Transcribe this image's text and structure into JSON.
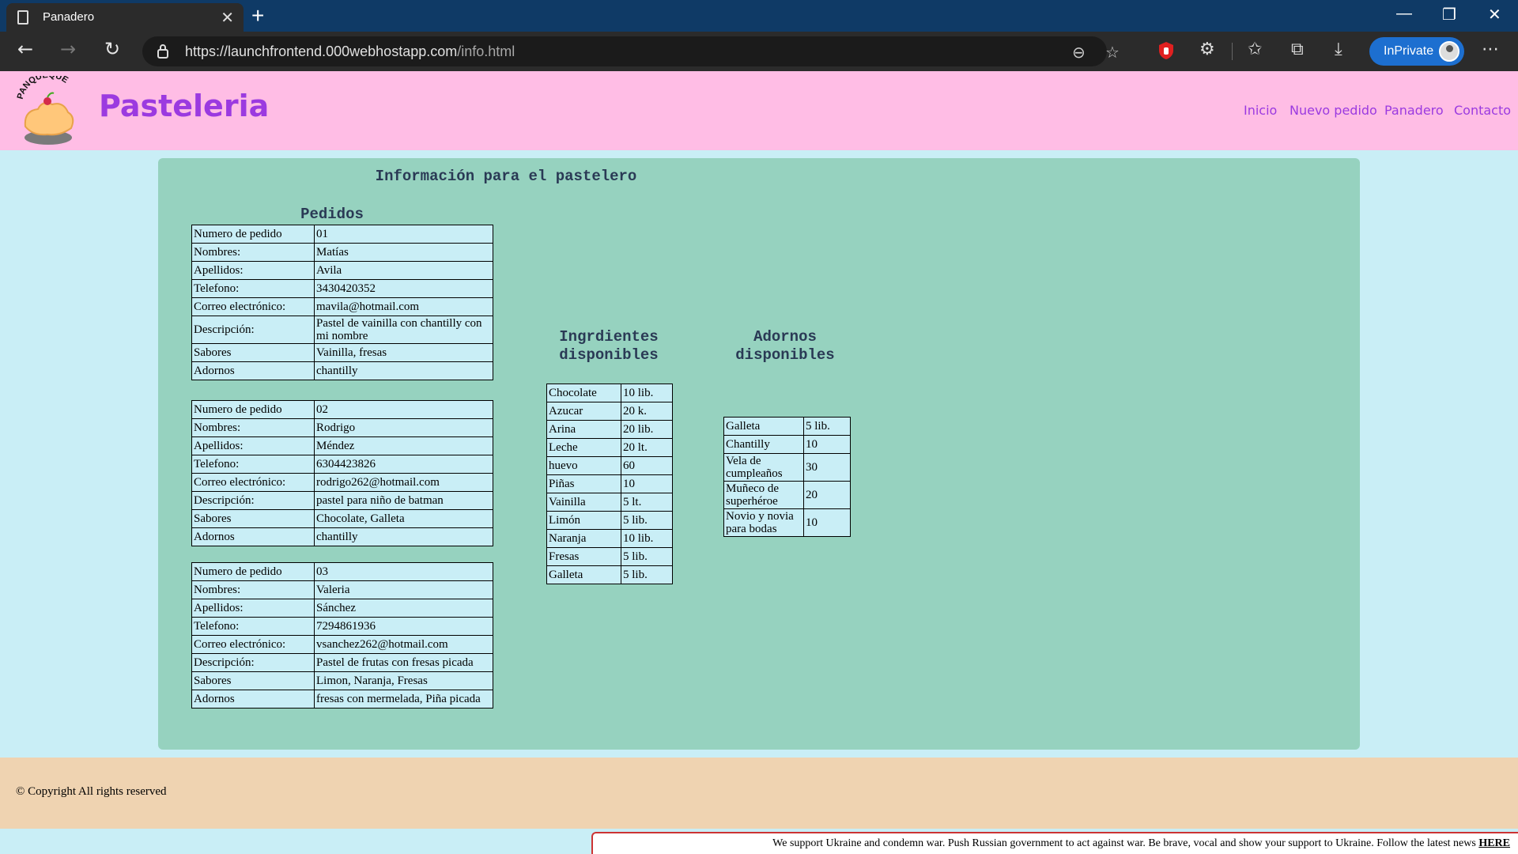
{
  "browser": {
    "tab_title": "Panadero",
    "tab_close": "✕",
    "new_tab": "+",
    "url_host": "https://launchfrontend.000webhostapp.com",
    "url_path": "/info.html",
    "inprivate_label": "InPrivate"
  },
  "header": {
    "logo_text": "PANQUEQUE",
    "brand": "Pasteleria",
    "nav": [
      "Inicio",
      "Nuevo pedido",
      "Panadero",
      "Contacto"
    ]
  },
  "main": {
    "title": "Información para el pastelero",
    "orders_title": "Pedidos",
    "orders": [
      {
        "rows": [
          [
            "Numero de pedido",
            "01"
          ],
          [
            "Nombres:",
            "Matías"
          ],
          [
            "Apellidos:",
            "Avila"
          ],
          [
            "Telefono:",
            "3430420352"
          ],
          [
            "Correo electrónico:",
            "mavila@hotmail.com"
          ],
          [
            "Descripción:",
            "Pastel de vainilla con chantilly con mi nombre"
          ],
          [
            "Sabores",
            "Vainilla, fresas"
          ],
          [
            "Adornos",
            "chantilly"
          ]
        ]
      },
      {
        "rows": [
          [
            "Numero de pedido",
            "02"
          ],
          [
            "Nombres:",
            "Rodrigo"
          ],
          [
            "Apellidos:",
            "Méndez"
          ],
          [
            "Telefono:",
            "6304423826"
          ],
          [
            "Correo electrónico:",
            "rodrigo262@hotmail.com"
          ],
          [
            "Descripción:",
            "pastel para niño de batman"
          ],
          [
            "Sabores",
            "Chocolate, Galleta"
          ],
          [
            "Adornos",
            "chantilly"
          ]
        ]
      },
      {
        "rows": [
          [
            "Numero de pedido",
            "03"
          ],
          [
            "Nombres:",
            "Valeria"
          ],
          [
            "Apellidos:",
            "Sánchez"
          ],
          [
            "Telefono:",
            "7294861936"
          ],
          [
            "Correo electrónico:",
            "vsanchez262@hotmail.com"
          ],
          [
            "Descripción:",
            "Pastel de frutas con fresas picada"
          ],
          [
            "Sabores",
            "Limon, Naranja, Fresas"
          ],
          [
            "Adornos",
            "fresas con mermelada, Piña picada"
          ]
        ]
      }
    ],
    "ingredients_title_1": "Ingrdientes",
    "ingredients_title_2": "disponibles",
    "ingredients": [
      [
        "Chocolate",
        "10 lib."
      ],
      [
        "Azucar",
        "20 k."
      ],
      [
        "Arina",
        "20 lib."
      ],
      [
        "Leche",
        "20 lt."
      ],
      [
        "huevo",
        "60"
      ],
      [
        "Piñas",
        "10"
      ],
      [
        "Vainilla",
        "5 lt."
      ],
      [
        "Limón",
        "5 lib."
      ],
      [
        "Naranja",
        "10 lib."
      ],
      [
        "Fresas",
        "5 lib."
      ],
      [
        "Galleta",
        "5 lib."
      ]
    ],
    "ornaments_title_1": "Adornos",
    "ornaments_title_2": "disponibles",
    "ornaments": [
      [
        "Galleta",
        "5 lib."
      ],
      [
        "Chantilly",
        "10"
      ],
      [
        "Vela de cumpleaños",
        "30"
      ],
      [
        "Muñeco de superhéroe",
        "20"
      ],
      [
        "Novio y novia para bodas",
        "10"
      ]
    ]
  },
  "footer": {
    "copyright": "© Copyright All rights reserved",
    "ukraine_msg": "We support Ukraine and condemn war. Push Russian government to act against war. Be brave, vocal and show your support to Ukraine. Follow the latest news",
    "ukraine_link": "HERE"
  }
}
